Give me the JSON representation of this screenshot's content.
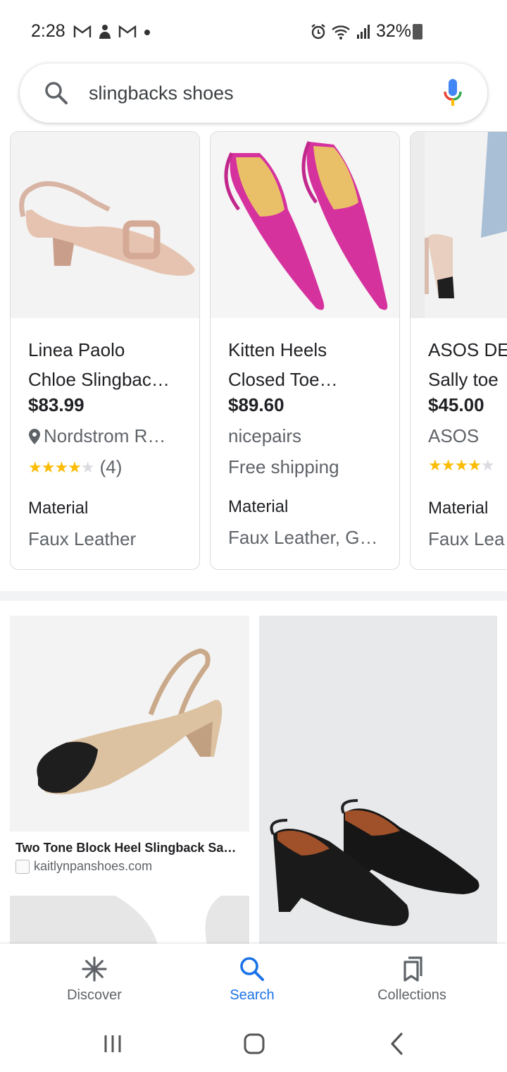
{
  "status_bar": {
    "time": "2:28",
    "battery": "32%",
    "icons": [
      "gmail-icon",
      "app-notification-icon",
      "gmail-icon",
      "dot-icon",
      "alarm-icon",
      "wifi-icon",
      "signal-icon",
      "battery-icon"
    ]
  },
  "search": {
    "query": "slingbacks shoes"
  },
  "products": [
    {
      "title_line1": "Linea Paolo",
      "title_line2": "Chloe Slingbac…",
      "price": "$83.99",
      "merchant": "Nordstrom R…",
      "rating": 4,
      "rating_count": "(4)",
      "attr_label": "Material",
      "attr_value": "Faux Leather"
    },
    {
      "title_line1": "Kitten Heels",
      "title_line2": "Closed Toe…",
      "price": "$89.60",
      "merchant": "nicepairs",
      "extra": "Free shipping",
      "attr_label": "Material",
      "attr_value": "Faux Leather, G…"
    },
    {
      "title_line1": "ASOS DE",
      "title_line2": "Sally toe",
      "price": "$45.00",
      "merchant": "ASOS",
      "rating": 4,
      "attr_label": "Material",
      "attr_value": "Faux Lea"
    }
  ],
  "image_results": [
    {
      "caption": "Two Tone Block Heel Slingback Sa…",
      "source": "kaitlynpanshoes.com"
    }
  ],
  "bottom_nav": {
    "discover": "Discover",
    "search": "Search",
    "collections": "Collections"
  },
  "colors": {
    "accent": "#1a73e8",
    "star": "#fbbc04",
    "secondary_text": "#5f6368"
  }
}
